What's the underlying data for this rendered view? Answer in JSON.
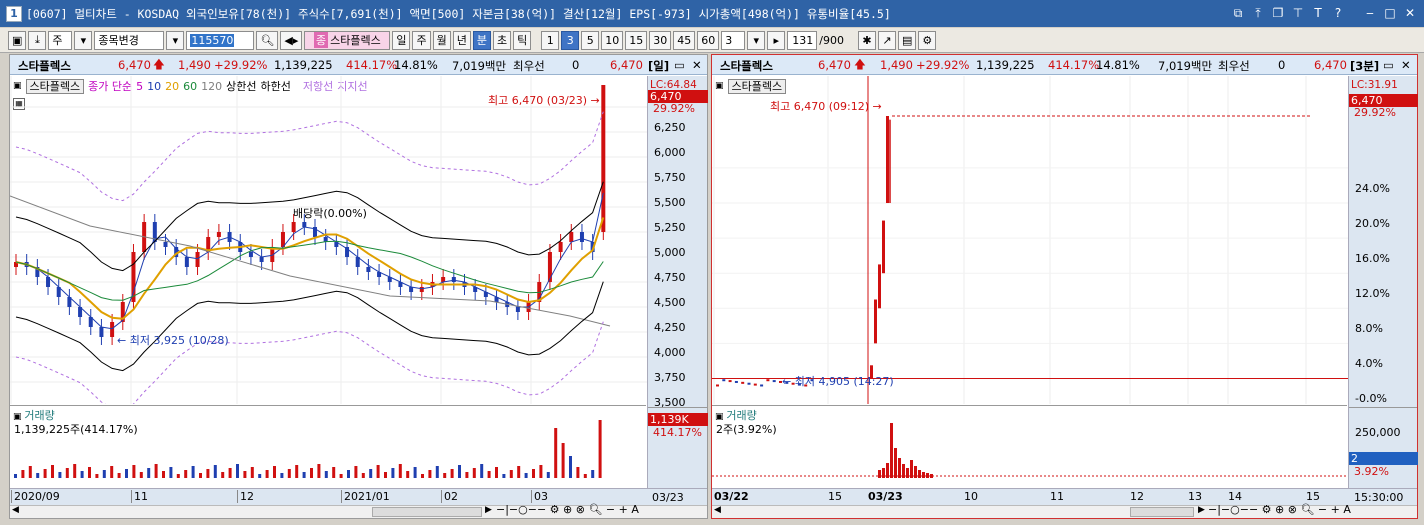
{
  "window": {
    "title": "[0607] 멀티차트 - KOSDAQ 외국인보유[78(천)] 주식수[7,691(천)] 액면[500] 자본금[38(억)] 결산[12월] EPS[-973] 시가총액[498(억)] 유통비율[45.5]",
    "icon_label": "1"
  },
  "toolbar": {
    "market": "주",
    "stock_select": "종목변경",
    "code": "115570",
    "stock_name": "스타플렉스",
    "stock_tag": "종",
    "periods": [
      "일",
      "주",
      "월",
      "년",
      "분",
      "초",
      "틱"
    ],
    "selected_period": "분",
    "intervals": [
      "1",
      "3",
      "5",
      "10",
      "15",
      "30",
      "45",
      "60"
    ],
    "selected_interval": "3",
    "count_select": "3",
    "page_current": "131",
    "page_total": "/900"
  },
  "left": {
    "info": {
      "name": "스타플렉스",
      "price": "6,470",
      "change": "1,490",
      "pct": "+29.92%",
      "volume": "1,139,225",
      "vol_pct": "414.17%",
      "turnover": "14.81%",
      "amount": "7,019백만",
      "pref": "최우선",
      "pref_val": "0",
      "price2": "6,470",
      "period": "[일]"
    },
    "legend": {
      "chart_name": "스타플렉스",
      "ma_label": "종가 단순",
      "ma": [
        "5",
        "10",
        "20",
        "60",
        "120"
      ],
      "bands": [
        "상한선",
        "하한선"
      ],
      "support": [
        "저항선",
        "지지선"
      ]
    },
    "annotations": {
      "high": "최고 6,470 (03/23)",
      "low": "최저 3,925 (10/28)",
      "dividend": "배당락(0.00%)"
    },
    "price_tags": {
      "lc": "LC:64.84",
      "last": "6,470",
      "pct": "29.92%"
    },
    "y_ticks": [
      "6,250",
      "6,000",
      "5,750",
      "5,500",
      "5,250",
      "5,000",
      "4,750",
      "4,500",
      "4,250",
      "4,000",
      "3,750",
      "3,500"
    ],
    "volume": {
      "title": "거래량",
      "value": "1,139,225주(414.17%)",
      "tag_k": "1,139K",
      "tag_pct": "414.17%"
    },
    "x_ticks": [
      "2020/09",
      "11",
      "12",
      "2021/01",
      "02",
      "03"
    ],
    "date_box": "03/23"
  },
  "right": {
    "info": {
      "name": "스타플렉스",
      "price": "6,470",
      "change": "1,490",
      "pct": "+29.92%",
      "volume": "1,139,225",
      "vol_pct": "414.17%",
      "turnover": "14.81%",
      "amount": "7,019백만",
      "pref": "최우선",
      "pref_val": "0",
      "price2": "6,470",
      "period": "[3분]"
    },
    "legend": {
      "chart_name": "스타플렉스"
    },
    "annotations": {
      "high": "최고 6,470 (09:12)",
      "low": "최저 4,905 (14:27)"
    },
    "price_tags": {
      "lc": "LC:31.91",
      "last": "6,470",
      "pct": "29.92%"
    },
    "y_ticks": [
      "24.0%",
      "20.0%",
      "16.0%",
      "12.0%",
      "8.0%",
      "4.0%",
      "-0.0%"
    ],
    "volume": {
      "title": "거래량",
      "value": "2주(3.92%)",
      "tick": "250,000",
      "tag": "2",
      "tag_pct": "3.92%"
    },
    "x_ticks": [
      "03/22",
      "15",
      "03/23",
      "10",
      "11",
      "12",
      "13",
      "14",
      "15"
    ],
    "time_box": "15:30:00"
  },
  "colors": {
    "up": "#d01010",
    "down": "#1f3fb0",
    "ma5": "#c000c0",
    "ma10": "#1f3fb0",
    "ma20": "#e0a000",
    "ma60": "#1b8a3a",
    "ma120": "#808080",
    "band": "#000000",
    "channel": "#b070e0"
  },
  "chart_data": [
    {
      "type": "candlestick",
      "title": "스타플렉스 [일]",
      "ylim": [
        3500,
        6470
      ],
      "series": [
        {
          "name": "5",
          "values_approx_close": [
            4700,
            4650,
            4550,
            4450,
            4350,
            4250,
            4150,
            4050,
            3950,
            4100,
            4300,
            4800,
            5100,
            4900,
            4850,
            4750,
            4650,
            4800,
            4950,
            5000,
            4900,
            4800,
            4750,
            4700,
            4850,
            5000,
            5100,
            5050,
            4950,
            4900,
            4850,
            4750,
            4650,
            4600,
            4550,
            4500,
            4450,
            4400,
            4450,
            4500,
            4550,
            4500,
            4450,
            4400,
            4350,
            4300,
            4250,
            4200,
            4300,
            4500,
            4800,
            4900,
            5000,
            4900,
            4800,
            6470
          ]
        },
        {
          "name": "20"
        },
        {
          "name": "60"
        },
        {
          "name": "120"
        }
      ],
      "annotations": [
        "최고 6,470 (03/23)",
        "최저 3,925 (10/28)",
        "배당락(0.00%)"
      ]
    },
    {
      "type": "bar",
      "title": "거래량",
      "last_value": "1,139,225주(414.17%)"
    },
    {
      "type": "line",
      "title": "스타플렉스 [3분]",
      "ylim_pct": [
        -0.0,
        29.92
      ],
      "annotations": [
        "최고 6,470 (09:12)",
        "최저 4,905 (14:27)"
      ]
    }
  ]
}
